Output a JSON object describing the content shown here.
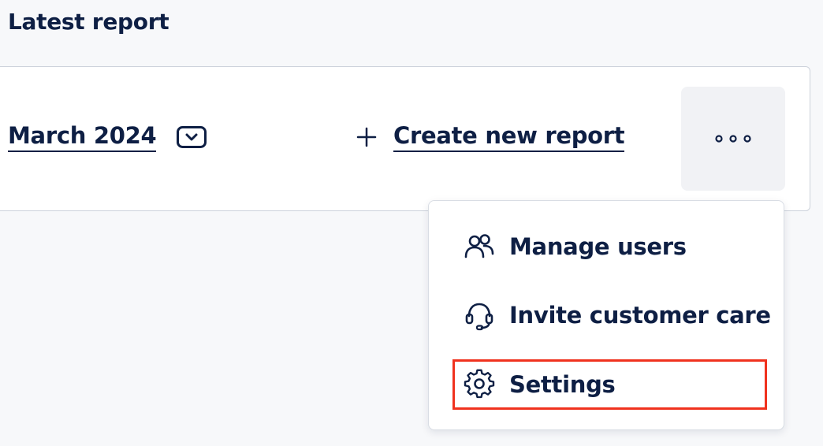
{
  "header": {
    "title": "Latest report"
  },
  "report": {
    "period_label": "March 2024",
    "create_label": "Create new report"
  },
  "menu": {
    "items": [
      {
        "label": "Manage users",
        "icon": "users-icon"
      },
      {
        "label": "Invite customer care",
        "icon": "headset-icon"
      },
      {
        "label": "Settings",
        "icon": "gear-icon",
        "highlighted": true
      }
    ]
  },
  "colors": {
    "text": "#0e1f44",
    "highlight": "#f0321e",
    "page_bg": "#f7f8fa",
    "button_bg": "#f1f2f5"
  }
}
